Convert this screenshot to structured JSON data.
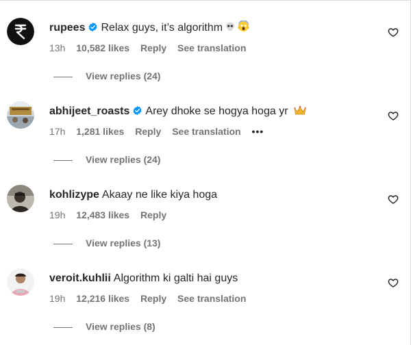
{
  "comments": [
    {
      "username": "rupees",
      "verified": true,
      "text": "Relax guys, it’s algorithm",
      "emoji": [
        "skull-emoji",
        "screaming-face-emoji"
      ],
      "time": "13h",
      "likes": "10,582 likes",
      "reply": "Reply",
      "translation": "See translation",
      "view_replies": "View replies (24)",
      "avatar": "rupee-logo"
    },
    {
      "username": "abhijeet_roasts",
      "verified": true,
      "text": "Arey dhoke se hogya hoga yr",
      "emoji": [
        "crown-emoji"
      ],
      "time": "17h",
      "likes": "1,281 likes",
      "reply": "Reply",
      "translation": "See translation",
      "more": "•••",
      "view_replies": "View replies (24)",
      "avatar": "photo-avatar"
    },
    {
      "username": "kohlizype",
      "verified": false,
      "text": "Akaay ne like kiya hoga",
      "time": "19h",
      "likes": "12,483 likes",
      "reply": "Reply",
      "view_replies": "View replies (13)",
      "avatar": "dark-photo-avatar"
    },
    {
      "username": "veroit.kuhlii",
      "verified": false,
      "text": "Algorithm ki galti hai guys",
      "time": "19h",
      "likes": "12,216 likes",
      "reply": "Reply",
      "translation": "See translation",
      "view_replies": "View replies (8)",
      "avatar": "person-photo-avatar"
    }
  ],
  "colors": {
    "verified_blue": "#0095f6",
    "meta_gray": "#737373",
    "text": "#262626"
  }
}
